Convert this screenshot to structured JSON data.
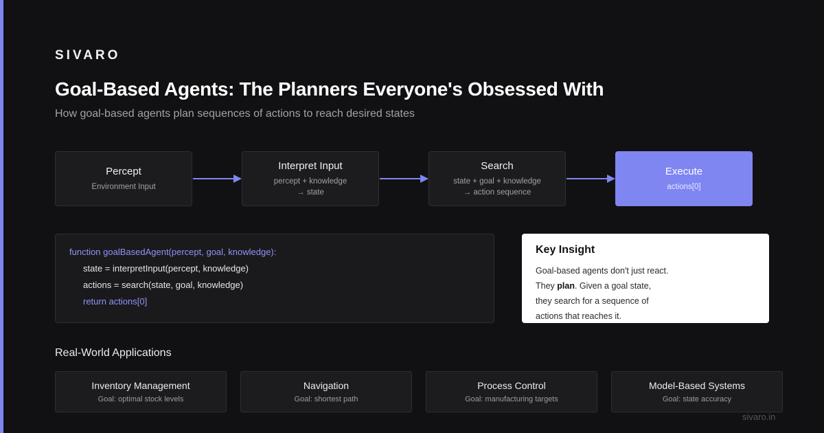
{
  "brand": "SIVARO",
  "title": "Goal-Based Agents: The Planners Everyone's Obsessed With",
  "subtitle": "How goal-based agents plan sequences of actions to reach desired states",
  "flow": [
    {
      "name": "Percept",
      "desc": [
        "Environment Input"
      ]
    },
    {
      "name": "Interpret Input",
      "desc": [
        "percept + knowledge",
        "→ state"
      ]
    },
    {
      "name": "Search",
      "desc": [
        "state + goal + knowledge",
        "→ action sequence"
      ]
    },
    {
      "name": "Execute",
      "desc": [
        "actions[0]"
      ]
    }
  ],
  "code": [
    "function goalBasedAgent(percept, goal, knowledge):",
    "state = interpretInput(percept, knowledge)",
    "actions = search(state, goal, knowledge)",
    "return actions[0]"
  ],
  "insight": {
    "heading": "Key Insight",
    "line1": "Goal-based agents don't just react.",
    "line2_pre": "They ",
    "line2_bold": "plan",
    "line2_post": ". Given a goal state,",
    "line3": "they search for a sequence of",
    "line4": "actions that reaches it."
  },
  "applications": {
    "heading": "Real-World Applications",
    "items": [
      {
        "name": "Inventory Management",
        "goal": "Goal: optimal stock levels"
      },
      {
        "name": "Navigation",
        "goal": "Goal: shortest path"
      },
      {
        "name": "Process Control",
        "goal": "Goal: manufacturing targets"
      },
      {
        "name": "Model-Based Systems",
        "goal": "Goal: state accuracy"
      }
    ]
  },
  "site": "sivaro.in",
  "colors": {
    "accent": "#7f86f2",
    "background": "#111113",
    "card": "#1c1c1f"
  }
}
